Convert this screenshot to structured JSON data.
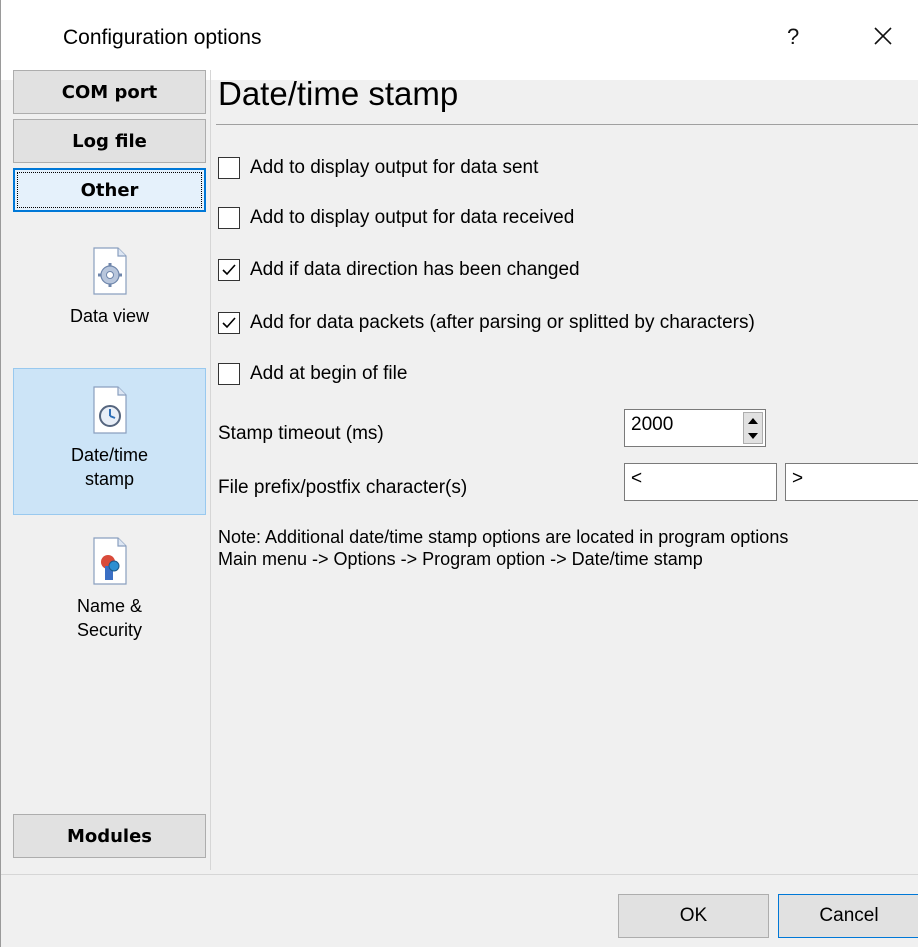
{
  "window": {
    "title": "Configuration options",
    "help_label": "?"
  },
  "nav": {
    "com_port": "COM port",
    "log_file": "Log file",
    "other": "Other",
    "items": [
      {
        "label": "Data view",
        "icon": "gear-document-icon"
      },
      {
        "label": "Date/time\nstamp",
        "icon": "clock-document-icon"
      },
      {
        "label": "Name &\nSecurity",
        "icon": "security-document-icon"
      }
    ],
    "modules": "Modules"
  },
  "content": {
    "title": "Date/time stamp",
    "checkboxes": [
      {
        "label": "Add to display output for data sent",
        "checked": false
      },
      {
        "label": "Add to display output for data received",
        "checked": false
      },
      {
        "label": "Add if data direction has been changed",
        "checked": true
      },
      {
        "label": "Add for data packets (after parsing or splitted by characters)",
        "checked": true
      },
      {
        "label": "Add at begin of file",
        "checked": false
      }
    ],
    "timeout_label": "Stamp timeout (ms)",
    "timeout_value": "2000",
    "prefix_label": "File prefix/postfix character(s)",
    "prefix_value": "<",
    "postfix_value": ">",
    "note_line1": "Note: Additional date/time stamp options are located in program options",
    "note_line2": "Main menu -> Options -> Program option -> Date/time stamp"
  },
  "footer": {
    "ok": "OK",
    "cancel": "Cancel"
  },
  "colors": {
    "accent": "#0078d7",
    "selection": "#cce4f7"
  }
}
